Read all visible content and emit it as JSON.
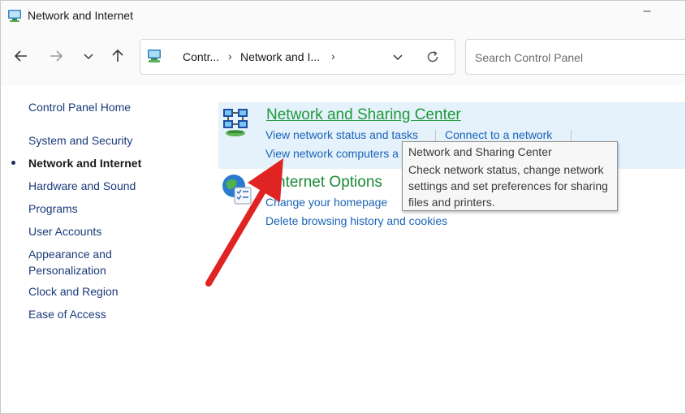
{
  "window": {
    "title": "Network and Internet",
    "minimize_glyph": "–"
  },
  "nav": {
    "back_icon": "arrow-left-icon",
    "forward_icon": "arrow-right-icon",
    "recent_icon": "chevron-down-icon",
    "up_icon": "arrow-up-icon"
  },
  "address": {
    "crumbs": [
      "Contr...",
      "Network and I..."
    ],
    "separator": "›",
    "refresh_icon": "refresh-icon"
  },
  "search": {
    "placeholder": "Search Control Panel"
  },
  "sidebar": {
    "items": [
      {
        "label": "Control Panel Home"
      },
      {
        "label": "System and Security"
      },
      {
        "label": "Network and Internet",
        "current": true
      },
      {
        "label": "Hardware and Sound"
      },
      {
        "label": "Programs"
      },
      {
        "label": "User Accounts"
      },
      {
        "label": "Appearance and",
        "label2": "Personalization"
      },
      {
        "label": "Clock and Region"
      },
      {
        "label": "Ease of Access"
      }
    ]
  },
  "categories": [
    {
      "title": "Network and Sharing Center",
      "icon": "network-sharing-icon",
      "tasks": [
        "View network status and tasks",
        "Connect to a network",
        "View network computers a"
      ]
    },
    {
      "title": "nternet Options",
      "icon": "internet-options-icon",
      "tasks": [
        "Change your homepage",
        "Delete browsing history and cookies"
      ]
    }
  ],
  "tooltip": {
    "title": "Network and Sharing Center",
    "body": "Check network status, change network settings and set preferences for sharing files and printers."
  },
  "colors": {
    "link_blue": "#1a64b8",
    "title_green": "#1a8a35",
    "highlight_bg": "#e5f1fb",
    "arrow_red": "#e02424"
  }
}
